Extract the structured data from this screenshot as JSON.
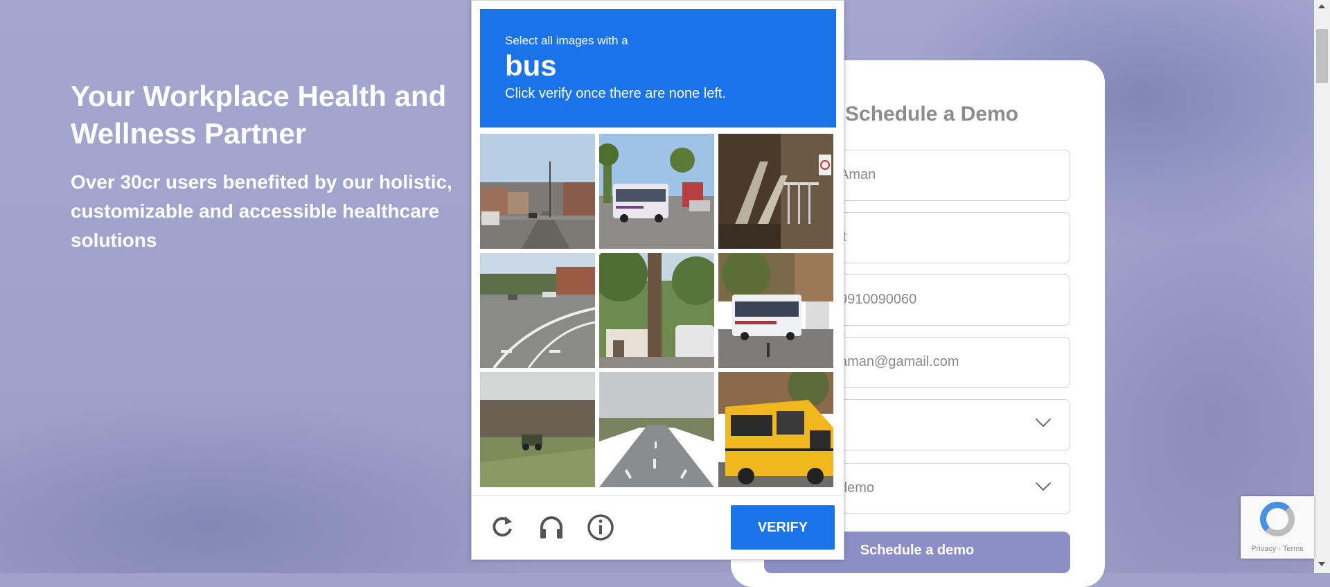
{
  "hero": {
    "title": "Your Workplace Health and Wellness Partner",
    "subtitle": "Over 30cr users benefited by our holistic, customizable and accessible healthcare solutions"
  },
  "form": {
    "title": "Schedule a Demo",
    "fields": [
      {
        "value": "Aman"
      },
      {
        "value": "it"
      },
      {
        "value": "9910090060"
      },
      {
        "value": "aman@gamail.com"
      },
      {
        "value": ""
      },
      {
        "value": "demo"
      }
    ],
    "submit_label": "Schedule a demo"
  },
  "recaptcha_badge": {
    "links": "Privacy - Terms"
  },
  "captcha": {
    "instruction": "Select all images with a",
    "target": "bus",
    "hint": "Click verify once there are none left.",
    "verify_label": "VERIFY",
    "tiles": [
      "street-town-scene",
      "street-with-bus",
      "stair-railing",
      "road-intersection",
      "palm-tree-house",
      "street-with-bus-2",
      "grass-field-tractor",
      "highway-road",
      "yellow-school-bus"
    ],
    "icons": [
      "reload-icon",
      "audio-icon",
      "info-icon"
    ]
  },
  "colors": {
    "accent": "#1a73e8",
    "cta": "#8c8fc5",
    "background": "#9fa3cc"
  }
}
